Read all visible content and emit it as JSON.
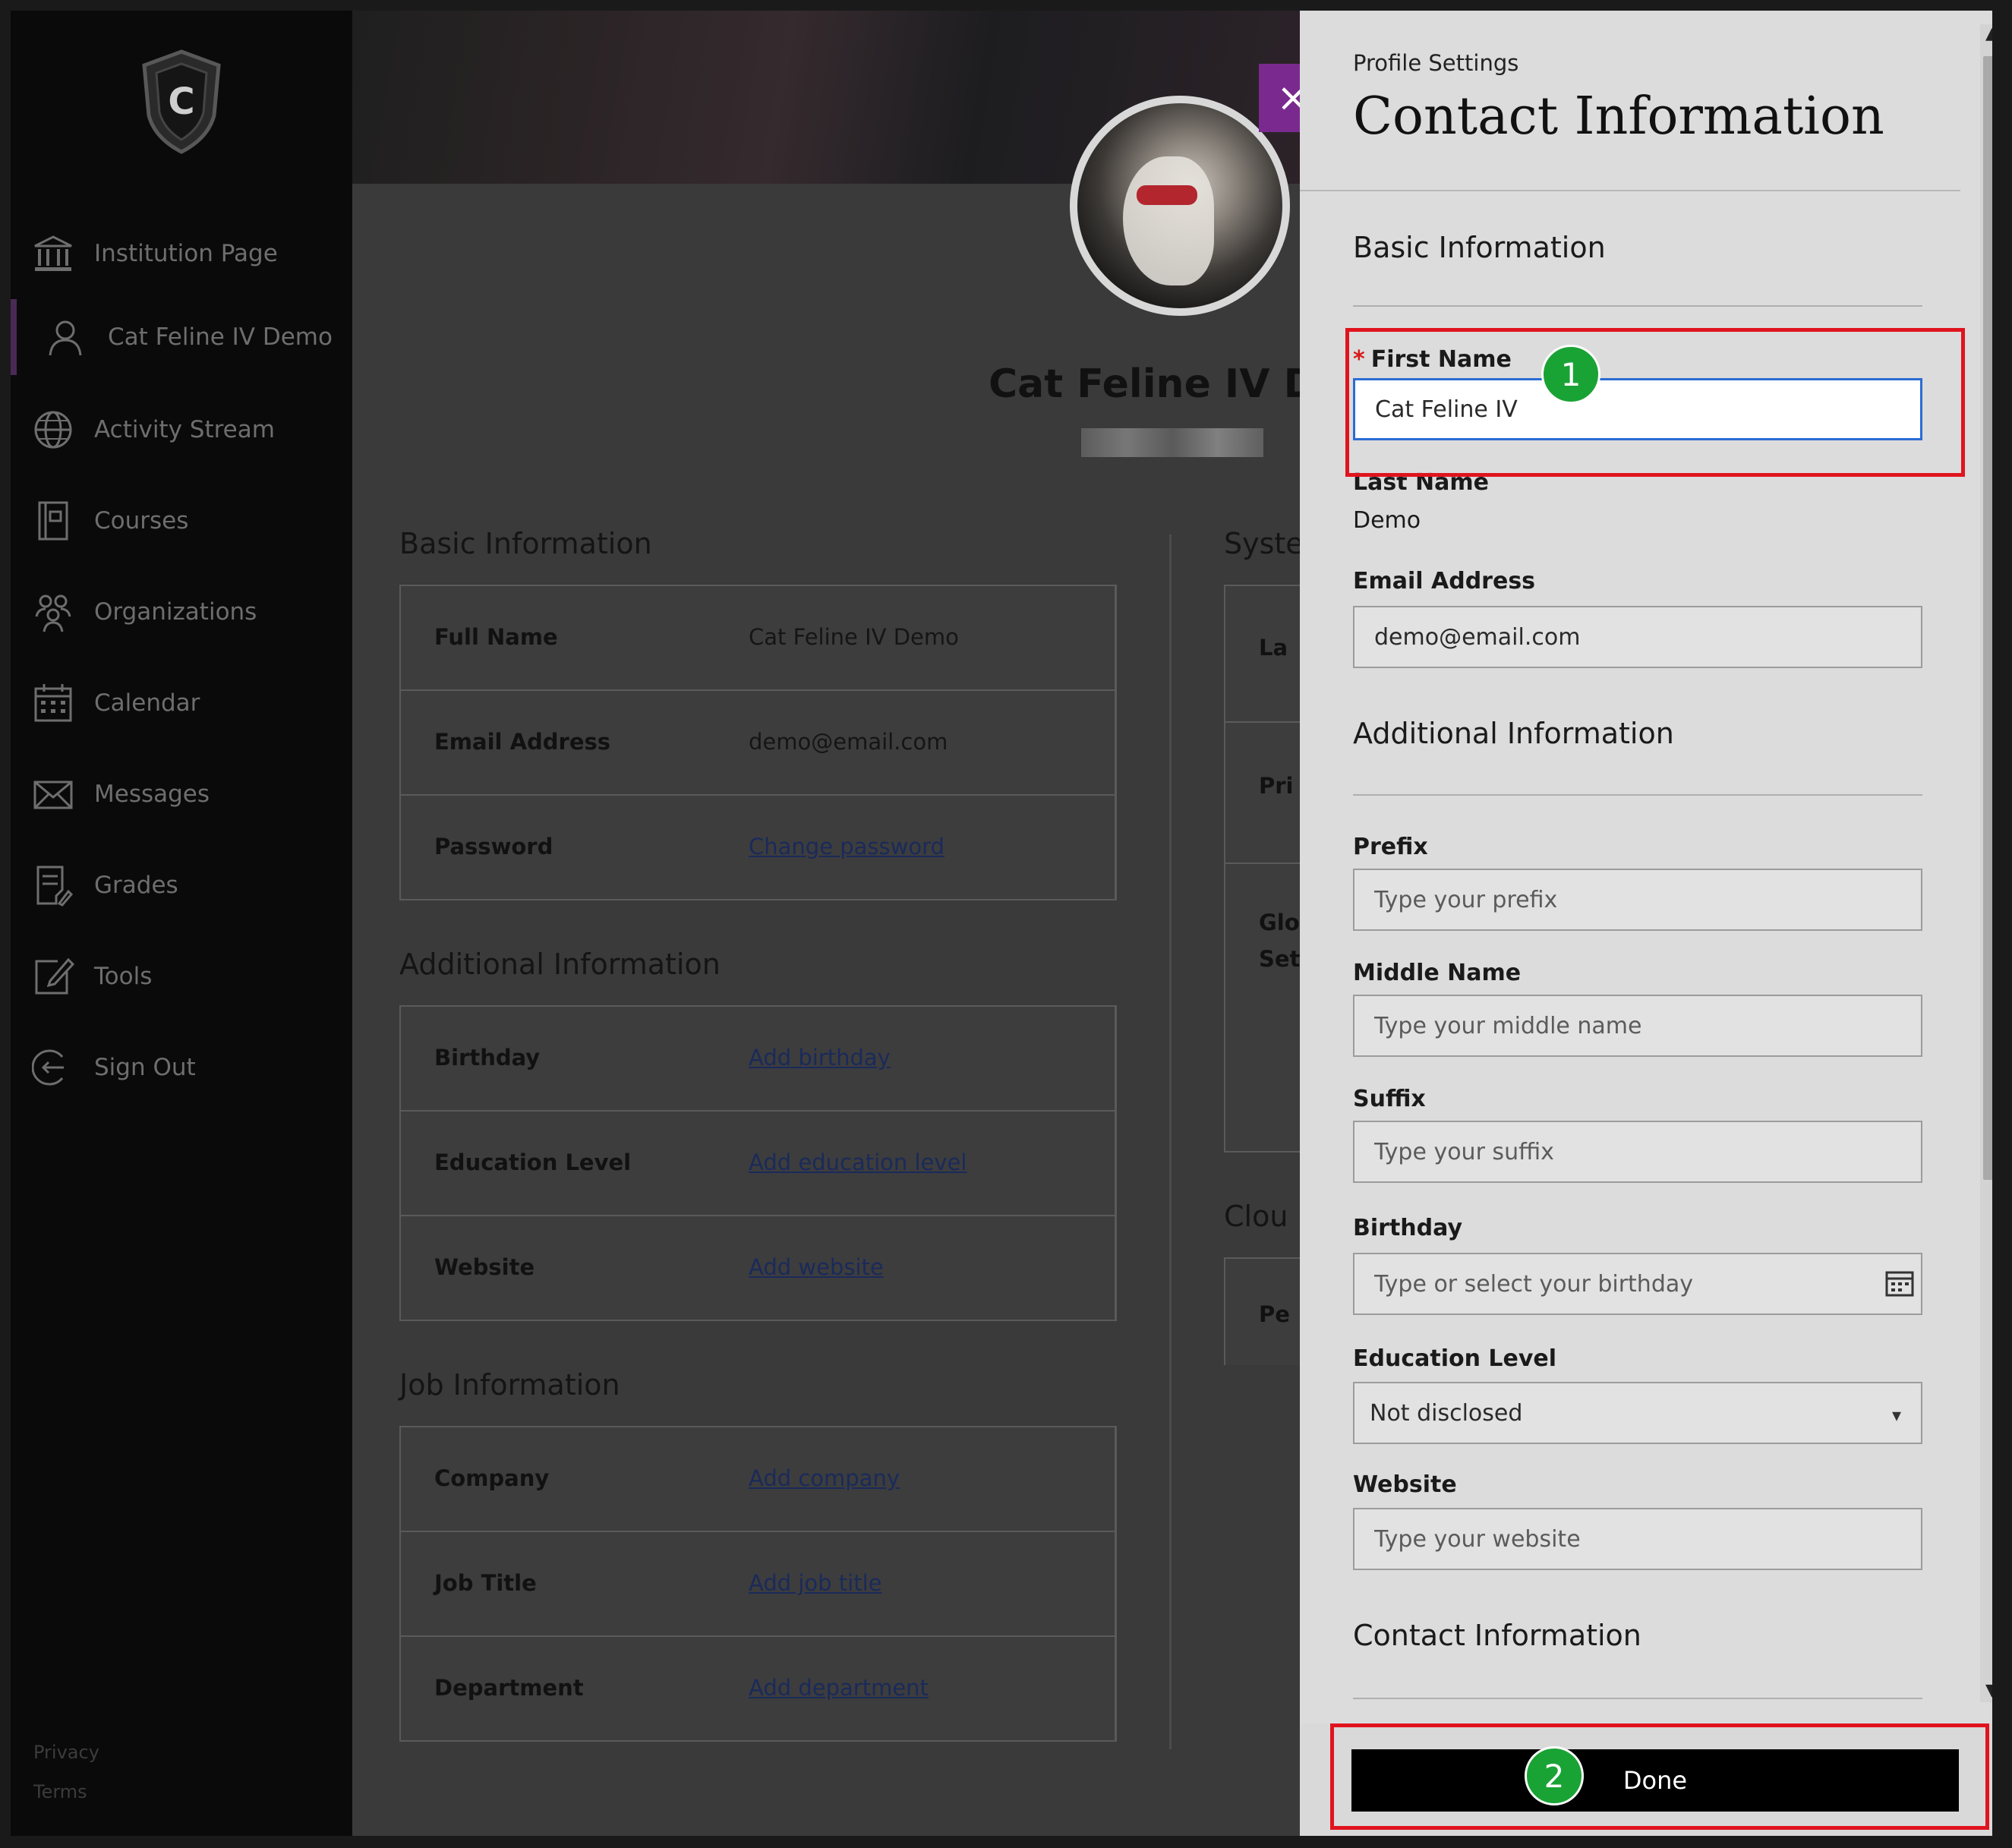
{
  "sidebar": {
    "logo_letter": "C",
    "items": [
      {
        "label": "Institution Page",
        "icon": "institution-icon"
      },
      {
        "label": "Cat Feline IV Demo",
        "icon": "user-icon"
      },
      {
        "label": "Activity Stream",
        "icon": "globe-icon"
      },
      {
        "label": "Courses",
        "icon": "book-icon"
      },
      {
        "label": "Organizations",
        "icon": "people-icon"
      },
      {
        "label": "Calendar",
        "icon": "calendar-icon"
      },
      {
        "label": "Messages",
        "icon": "envelope-icon"
      },
      {
        "label": "Grades",
        "icon": "grades-icon"
      },
      {
        "label": "Tools",
        "icon": "tools-icon"
      },
      {
        "label": "Sign Out",
        "icon": "sign-out-icon"
      }
    ],
    "footer": [
      "Privacy",
      "Terms"
    ]
  },
  "profile": {
    "name": "Cat Feline IV De",
    "basic": {
      "title": "Basic Information",
      "rows": [
        {
          "key": "Full Name",
          "value": "Cat Feline IV Demo"
        },
        {
          "key": "Email Address",
          "value": "demo@email.com"
        },
        {
          "key": "Password",
          "value": "Change password"
        }
      ]
    },
    "additional": {
      "title": "Additional Information",
      "rows": [
        {
          "key": "Birthday",
          "value": "Add birthday"
        },
        {
          "key": "Education Level",
          "value": "Add education level"
        },
        {
          "key": "Website",
          "value": "Add website"
        }
      ]
    },
    "job": {
      "title": "Job Information",
      "rows": [
        {
          "key": "Company",
          "value": "Add company"
        },
        {
          "key": "Job Title",
          "value": "Add job title"
        },
        {
          "key": "Department",
          "value": "Add department"
        }
      ]
    },
    "right_col": {
      "system_title": "Syste",
      "labels": [
        "La",
        "Pri",
        "Glo",
        "Set",
        "Pe"
      ],
      "cloud_title": "Clou"
    }
  },
  "panel": {
    "breadcrumb": "Profile Settings",
    "title": "Contact Information",
    "close_symbol": "×",
    "basic_heading": "Basic Information",
    "first_name_label": "First Name",
    "first_name_value": "Cat Feline IV",
    "last_name_label": "Last Name",
    "last_name_value": "Demo",
    "email_label": "Email Address",
    "email_value": "demo@email.com",
    "additional_heading": "Additional Information",
    "prefix_label": "Prefix",
    "prefix_placeholder": "Type your prefix",
    "middle_label": "Middle Name",
    "middle_placeholder": "Type your middle name",
    "suffix_label": "Suffix",
    "suffix_placeholder": "Type your suffix",
    "birthday_label": "Birthday",
    "birthday_placeholder": "Type or select your birthday",
    "education_label": "Education Level",
    "education_value": "Not disclosed",
    "website_label": "Website",
    "website_placeholder": "Type your website",
    "contact_heading": "Contact Information",
    "done_label": "Done"
  },
  "annotations": {
    "badge_1": "1",
    "badge_2": "2",
    "highlight_color": "#e0141e",
    "badge_color": "#1aa335"
  },
  "colors": {
    "accent_close": "#7a2a8e",
    "focus_border": "#2b6cd4"
  }
}
